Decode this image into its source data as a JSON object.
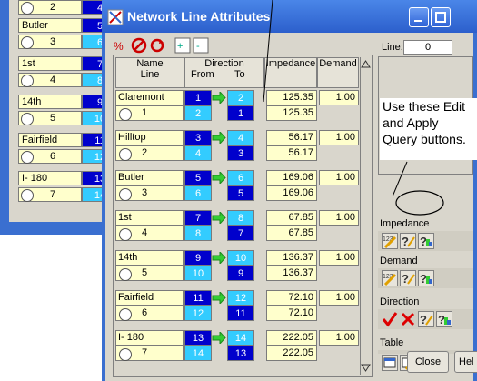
{
  "background_window": {
    "rows": [
      {
        "id": "2",
        "from": "4"
      },
      {
        "name": "Butler",
        "from": "5"
      },
      {
        "id": "3",
        "from": "6"
      },
      {
        "name": "1st",
        "from": "7"
      },
      {
        "id": "4",
        "from": "8"
      },
      {
        "name": "14th",
        "from": "9"
      },
      {
        "id": "5",
        "from": "10"
      },
      {
        "name": "Fairfield",
        "from": "11"
      },
      {
        "id": "6",
        "from": "12"
      },
      {
        "name": "I- 180",
        "from": "13"
      },
      {
        "id": "7",
        "from": "14"
      }
    ],
    "partial_value": "1.00"
  },
  "window": {
    "title": "Network Line Attributes"
  },
  "grid": {
    "headers": {
      "name_line": [
        "Name",
        "Line"
      ],
      "direction": "Direction",
      "from": "From",
      "to": "To",
      "impedance": "Impedance",
      "demand": "Demand"
    },
    "rows": [
      {
        "name": "Claremont",
        "id": "1",
        "from": "1",
        "to": "2",
        "imp_fwd": "125.35",
        "imp_rev": "125.35",
        "demand": "1.00"
      },
      {
        "name": "Hilltop",
        "id": "2",
        "from": "3",
        "to": "4",
        "imp_fwd": "56.17",
        "imp_rev": "56.17",
        "demand": "1.00"
      },
      {
        "name": "Butler",
        "id": "3",
        "from": "5",
        "to": "6",
        "imp_fwd": "169.06",
        "imp_rev": "169.06",
        "demand": "1.00"
      },
      {
        "name": "1st",
        "id": "4",
        "from": "7",
        "to": "8",
        "imp_fwd": "67.85",
        "imp_rev": "67.85",
        "demand": "1.00"
      },
      {
        "name": "14th",
        "id": "5",
        "from": "9",
        "to": "10",
        "imp_fwd": "136.37",
        "imp_rev": "136.37",
        "demand": "1.00"
      },
      {
        "name": "Fairfield",
        "id": "6",
        "from": "11",
        "to": "12",
        "imp_fwd": "72.10",
        "imp_rev": "72.10",
        "demand": "1.00"
      },
      {
        "name": "I- 180",
        "id": "7",
        "from": "13",
        "to": "14",
        "imp_fwd": "222.05",
        "imp_rev": "222.05",
        "demand": "1.00"
      }
    ]
  },
  "right_panel": {
    "line_label": "Line:",
    "line_value": "0",
    "impedance_label": "Impedance",
    "demand_label": "Demand",
    "direction_label": "Direction",
    "table_label": "Table",
    "close_label": "Close",
    "help_label": "Hel"
  },
  "callout": {
    "lines": [
      "Use these Edit",
      "and Apply",
      "Query buttons."
    ]
  },
  "colors": {
    "from_node": "#0000cc",
    "to_node": "#33ccff",
    "cell": "#ffffcc",
    "arrow": "#33cc33",
    "titlebar": "#3a6fd0"
  }
}
